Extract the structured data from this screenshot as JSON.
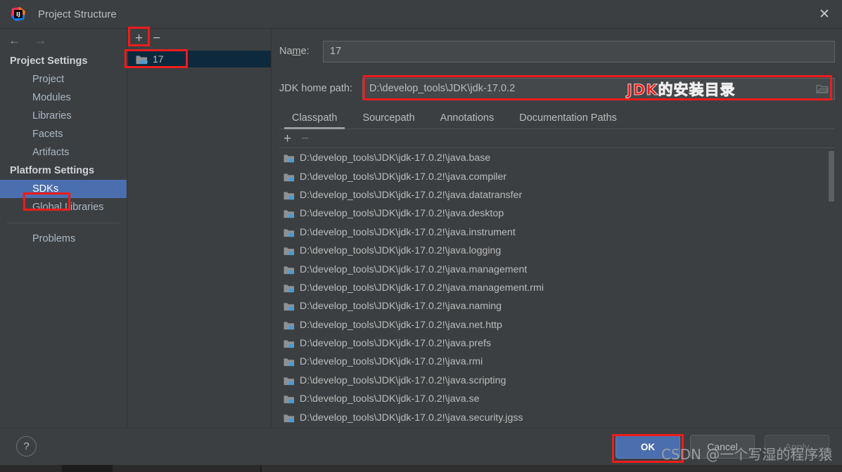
{
  "window": {
    "title": "Project Structure",
    "app_icon": "intellij-idea-logo",
    "close_label": "✕"
  },
  "nav": {
    "back_icon": "←",
    "forward_icon": "→",
    "groups": [
      {
        "heading": "Project Settings",
        "items": [
          {
            "label": "Project",
            "selected": false
          },
          {
            "label": "Modules",
            "selected": false
          },
          {
            "label": "Libraries",
            "selected": false
          },
          {
            "label": "Facets",
            "selected": false
          },
          {
            "label": "Artifacts",
            "selected": false
          }
        ]
      },
      {
        "heading": "Platform Settings",
        "items": [
          {
            "label": "SDKs",
            "selected": true
          },
          {
            "label": "Global Libraries",
            "selected": false
          }
        ]
      }
    ],
    "problems_label": "Problems"
  },
  "sdk_tree": {
    "add_label": "+",
    "remove_label": "−",
    "items": [
      {
        "label": "17",
        "icon": "jdk-folder-icon",
        "selected": true
      }
    ]
  },
  "detail": {
    "name_label_prefix": "Na",
    "name_label_mnemonic": "m",
    "name_label_suffix": "e:",
    "name_value": "17",
    "jdk_home_label": "JDK home path:",
    "jdk_home_value": "D:\\develop_tools\\JDK\\jdk-17.0.2",
    "browse_icon": "folder-icon",
    "tabs": [
      {
        "label": "Classpath",
        "active": true
      },
      {
        "label": "Sourcepath",
        "active": false
      },
      {
        "label": "Annotations",
        "active": false
      },
      {
        "label": "Documentation Paths",
        "active": false
      }
    ],
    "list_toolbar": {
      "add_label": "+",
      "remove_label": "−"
    },
    "classpath_entries": [
      "D:\\develop_tools\\JDK\\jdk-17.0.2!\\java.base",
      "D:\\develop_tools\\JDK\\jdk-17.0.2!\\java.compiler",
      "D:\\develop_tools\\JDK\\jdk-17.0.2!\\java.datatransfer",
      "D:\\develop_tools\\JDK\\jdk-17.0.2!\\java.desktop",
      "D:\\develop_tools\\JDK\\jdk-17.0.2!\\java.instrument",
      "D:\\develop_tools\\JDK\\jdk-17.0.2!\\java.logging",
      "D:\\develop_tools\\JDK\\jdk-17.0.2!\\java.management",
      "D:\\develop_tools\\JDK\\jdk-17.0.2!\\java.management.rmi",
      "D:\\develop_tools\\JDK\\jdk-17.0.2!\\java.naming",
      "D:\\develop_tools\\JDK\\jdk-17.0.2!\\java.net.http",
      "D:\\develop_tools\\JDK\\jdk-17.0.2!\\java.prefs",
      "D:\\develop_tools\\JDK\\jdk-17.0.2!\\java.rmi",
      "D:\\develop_tools\\JDK\\jdk-17.0.2!\\java.scripting",
      "D:\\develop_tools\\JDK\\jdk-17.0.2!\\java.se",
      "D:\\develop_tools\\JDK\\jdk-17.0.2!\\java.security.jgss"
    ]
  },
  "footer": {
    "help_label": "?",
    "ok_label": "OK",
    "cancel_label": "Cancel",
    "apply_label": "Apply"
  },
  "annotations": {
    "jdk_path_note": "JDK的安装目录",
    "watermark": "CSDN @一个写湿的程序猿",
    "highlight_color": "#ee1c1c"
  },
  "colors": {
    "window_bg": "#3c3f41",
    "selection_blue": "#4b6eaf",
    "tree_selection": "#0d293e",
    "text": "#bbbbbb",
    "nav_text": "#a9b7c6"
  }
}
